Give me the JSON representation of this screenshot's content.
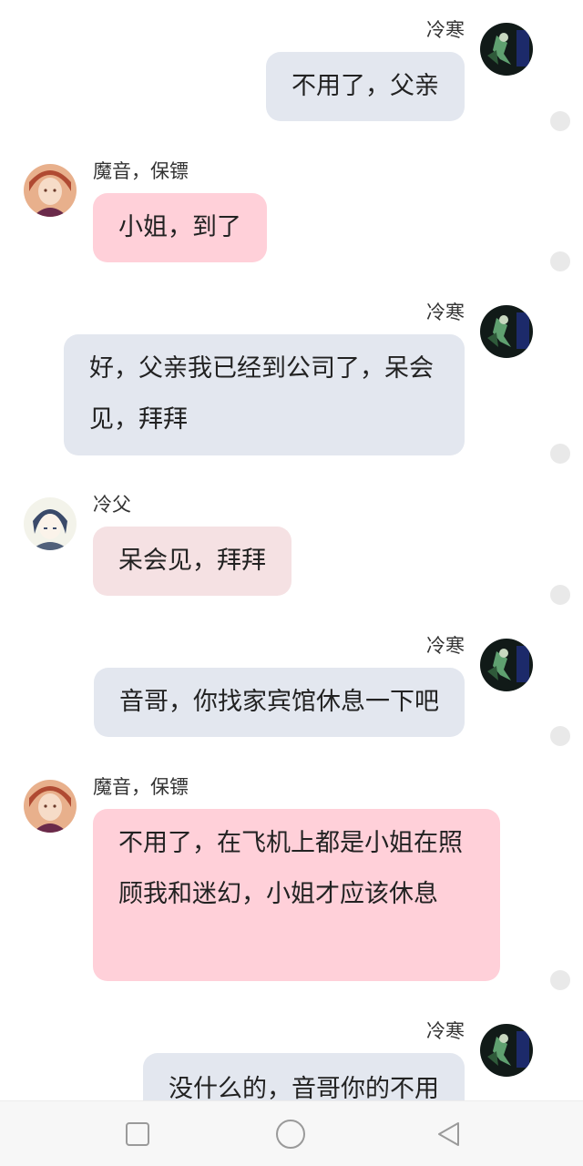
{
  "messages": [
    {
      "sender": "冷寒",
      "side": "right",
      "text": "不用了，父亲"
    },
    {
      "sender": "魔音，保镖",
      "side": "left",
      "text": "小姐，到了"
    },
    {
      "sender": "冷寒",
      "side": "right",
      "text": "好，父亲我已经到公司了，呆会见，拜拜"
    },
    {
      "sender": "冷父",
      "side": "left",
      "text": "呆会见，拜拜"
    },
    {
      "sender": "冷寒",
      "side": "right",
      "text": "音哥，你找家宾馆休息一下吧"
    },
    {
      "sender": "魔音，保镖",
      "side": "left",
      "text": "不用了，在飞机上都是小姐在照顾我和迷幻，小姐才应该休息"
    },
    {
      "sender": "冷寒",
      "side": "right",
      "text": "没什么的，音哥你的不用"
    }
  ],
  "colors": {
    "self_bubble": "#e3e7ef",
    "bodyguard_bubble": "#ffd0d9",
    "father_bubble": "#f5e1e3",
    "nav_bar": "#f7f7f7"
  },
  "nav": {
    "recents_icon": "square-icon",
    "home_icon": "circle-icon",
    "back_icon": "triangle-back-icon"
  }
}
